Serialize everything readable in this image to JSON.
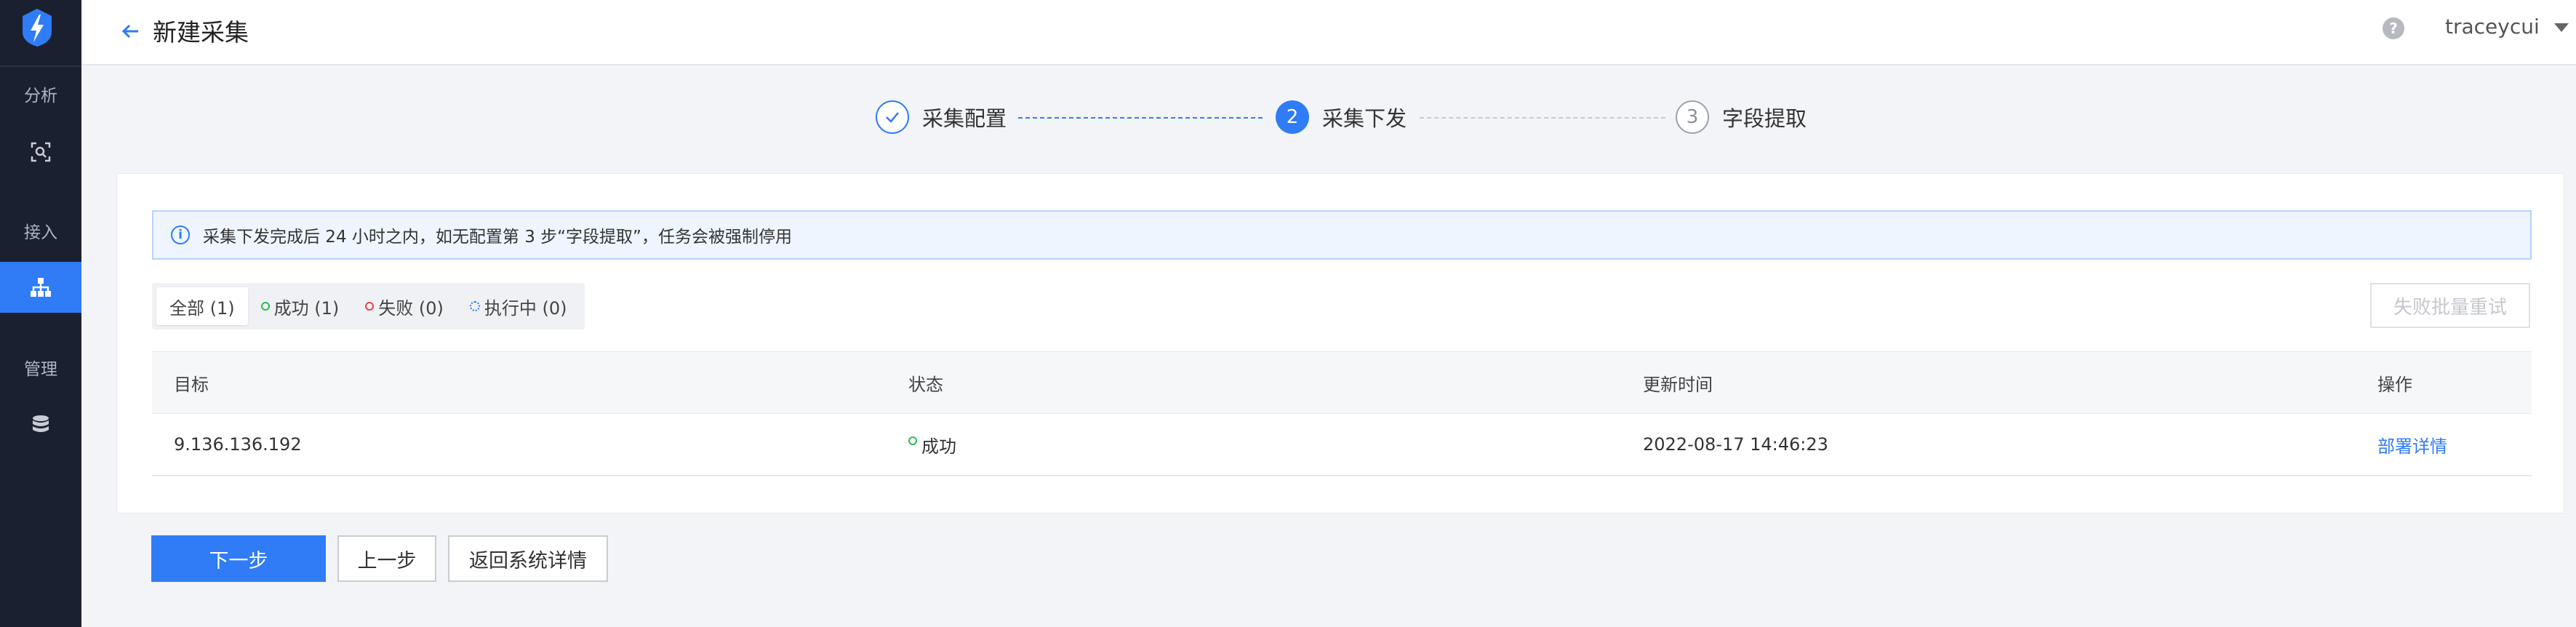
{
  "sidebar": {
    "sections": [
      {
        "label": "分析",
        "icon": "scan-icon"
      },
      {
        "label": "接入",
        "icon": "sitemap-icon",
        "active": true
      },
      {
        "label": "管理",
        "icon": "database-icon"
      }
    ]
  },
  "header": {
    "title": "新建采集",
    "help_glyph": "?",
    "user": "traceycui"
  },
  "steps": [
    {
      "label": "采集配置",
      "status": "done"
    },
    {
      "number": "2",
      "label": "采集下发",
      "status": "current"
    },
    {
      "number": "3",
      "label": "字段提取",
      "status": "todo"
    }
  ],
  "alert": {
    "icon_glyph": "i",
    "text": "采集下发完成后 24 小时之内，如无配置第 3 步“字段提取”，任务会被强制停用"
  },
  "filters": [
    {
      "label": "全部 (1)",
      "active": true
    },
    {
      "label": "成功 (1)",
      "status": "success"
    },
    {
      "label": "失败 (0)",
      "status": "fail"
    },
    {
      "label": "执行中 (0)",
      "status": "running"
    }
  ],
  "retry_button": "失败批量重试",
  "table": {
    "columns": [
      "目标",
      "状态",
      "更新时间",
      "操作"
    ],
    "rows": [
      {
        "target": "9.136.136.192",
        "status": "成功",
        "time": "2022-08-17 14:46:23",
        "action": "部署详情"
      }
    ]
  },
  "buttons": {
    "next": "下一步",
    "prev": "上一步",
    "back": "返回系统详情"
  },
  "colors": {
    "primary": "#2f7cf6",
    "sidebar_bg": "#1b2030",
    "success": "#2dbb55",
    "fail": "#e54545"
  }
}
